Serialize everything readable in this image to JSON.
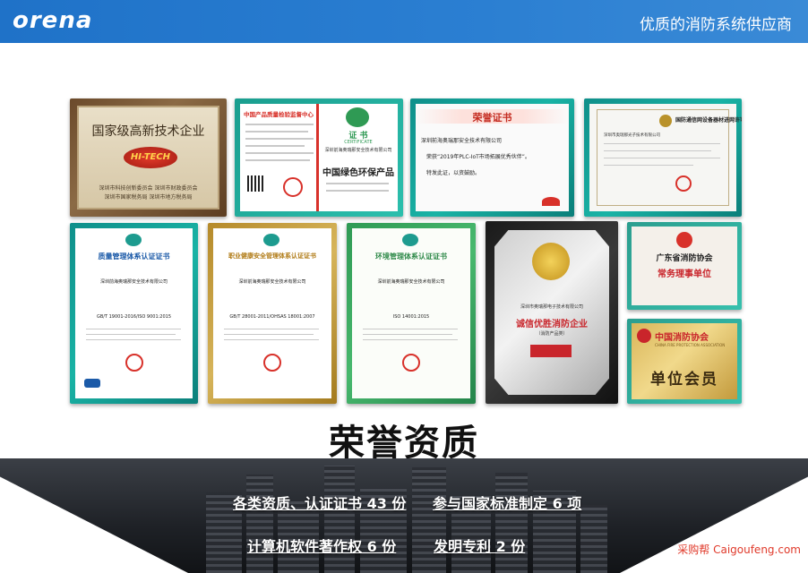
{
  "header": {
    "logo": "orena",
    "tagline": "优质的消防系统供应商"
  },
  "certificates": {
    "c1": {
      "title": "国家级高新技术企业",
      "badge": "HI-TECH",
      "issuer": "深圳市科技创新委员会  深圳市财政委员会\n深圳市国家税务局  深圳市地方税务局"
    },
    "c2": {
      "left_title": "中国产品质量检验监督中心",
      "right_title": "证  书",
      "right_sub": "CERTIFICATE",
      "product": "中国绿色环保产品",
      "company": "深圳前海奥瑞那安全技术有限公司"
    },
    "c3": {
      "title": "荣誉证书",
      "company": "深圳前海奥瑞那安全技术有限公司",
      "body": "荣获“2019年PLC-IoT市场拓展优秀伙伴”。",
      "note": "特发此证，以资鼓励。"
    },
    "c4": {
      "title": "国防通信网设备器材进网许可证",
      "company": "深圳市奥瑞那光子技术有限公司"
    },
    "c5": {
      "title": "质量管理体系认证证书",
      "company": "深圳前海奥瑞那安全技术有限公司",
      "std": "GB/T 19001-2016/ISO 9001:2015"
    },
    "c6": {
      "title": "职业健康安全管理体系认证证书",
      "company": "深圳前海奥瑞那安全技术有限公司",
      "std": "GB/T 28001-2011/OHSAS 18001:2007"
    },
    "c7": {
      "title": "环境管理体系认证证书",
      "company": "深圳前海奥瑞那安全技术有限公司",
      "std": "ISO 14001:2015"
    },
    "c8": {
      "company": "深圳市奥瑞那电子技术有限公司",
      "title": "诚信优胜消防企业",
      "sub": "（消防产品类）"
    },
    "c9": {
      "org": "广东省消防协会",
      "title": "常务理事单位"
    },
    "c10": {
      "org": "中国消防协会",
      "org_en": "CHINA FIRE PROTECTION ASSOCIATION",
      "title": "单位会员"
    }
  },
  "section_title": "荣誉资质",
  "stats": [
    {
      "text": "各类资质、认证证书 43 份"
    },
    {
      "text": "参与国家标准制定 6 项"
    },
    {
      "text": "计算机软件著作权 6 份"
    },
    {
      "text": "发明专利 2 份"
    }
  ],
  "watermark": "采购帮 Caigoufeng.com",
  "colors": {
    "header": "#2776cc",
    "teal_frame": "#19b3a5",
    "green_frame": "#48b86e",
    "red": "#d8312a"
  }
}
